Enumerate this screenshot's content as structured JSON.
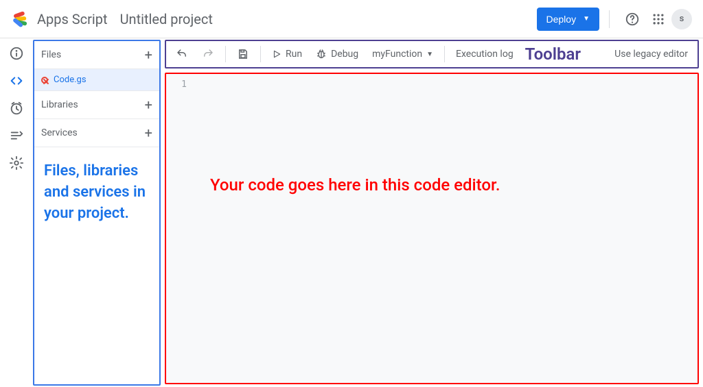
{
  "header": {
    "product_name": "Apps Script",
    "project_name": "Untitled project",
    "deploy_label": "Deploy",
    "avatar_initial": "s"
  },
  "rail": {
    "items": [
      {
        "id": "overview",
        "icon": "info"
      },
      {
        "id": "editor",
        "icon": "code",
        "active": true
      },
      {
        "id": "triggers",
        "icon": "clock"
      },
      {
        "id": "executions",
        "icon": "list"
      },
      {
        "id": "settings",
        "icon": "gear"
      }
    ]
  },
  "sidebar": {
    "sections": [
      {
        "label": "Files"
      },
      {
        "label": "Libraries"
      },
      {
        "label": "Services"
      }
    ],
    "active_file": "Code.gs",
    "annotation": "Files, libraries and services in your project."
  },
  "toolbar": {
    "run_label": "Run",
    "debug_label": "Debug",
    "func_label": "myFunction",
    "exec_log_label": "Execution log",
    "legacy_label": "Use legacy editor",
    "annotation": "Toolbar"
  },
  "editor": {
    "line_number": "1",
    "annotation": "Your code goes here in this code editor."
  },
  "colors": {
    "blue_accent": "#1a73e8",
    "toolbar_border": "#4d3f91",
    "sidebar_border": "#3b78e7",
    "editor_border": "#ff0000"
  }
}
